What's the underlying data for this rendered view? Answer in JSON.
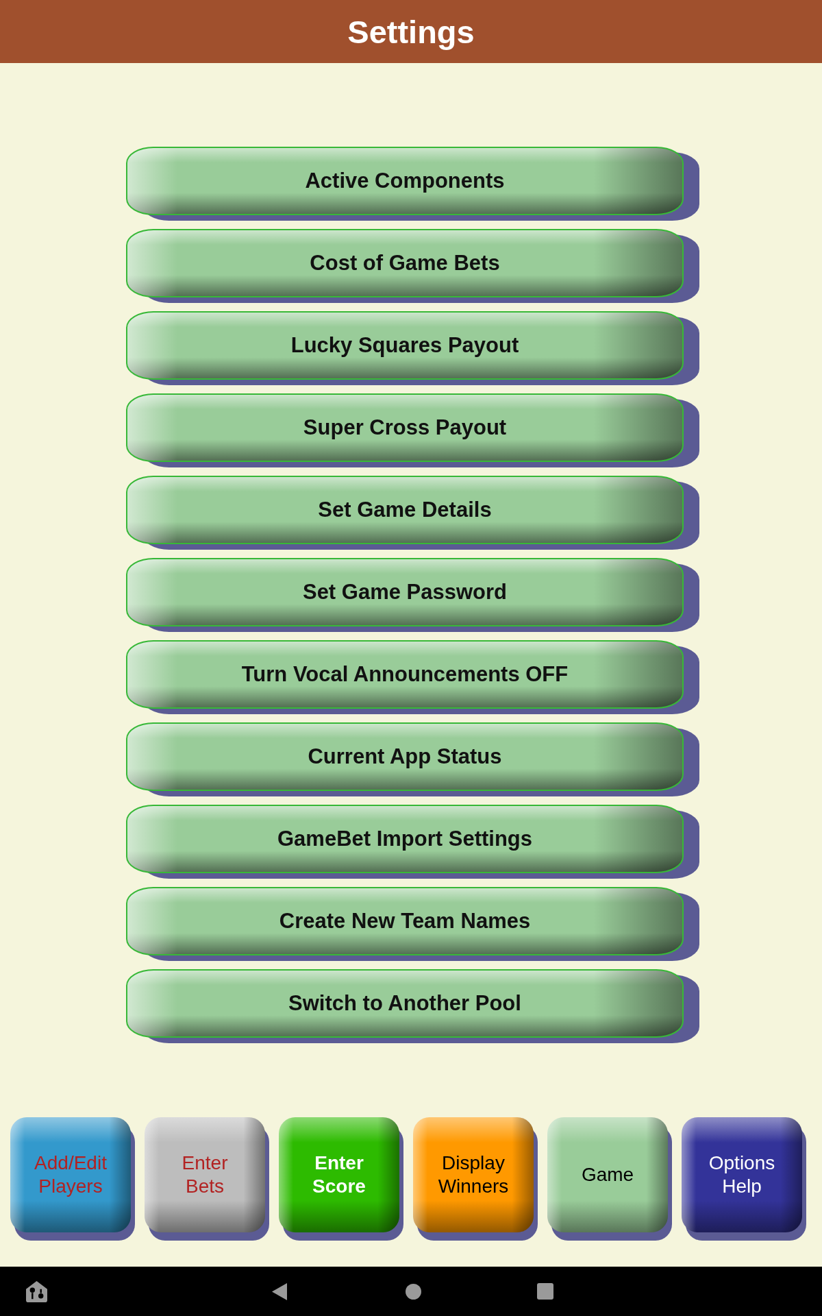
{
  "header": {
    "title": "Settings"
  },
  "settings_buttons": [
    {
      "label": "Active Components"
    },
    {
      "label": "Cost of Game Bets"
    },
    {
      "label": "Lucky Squares Payout"
    },
    {
      "label": "Super Cross Payout"
    },
    {
      "label": "Set Game Details"
    },
    {
      "label": "Set Game Password"
    },
    {
      "label": "Turn Vocal Announcements OFF"
    },
    {
      "label": "Current App Status"
    },
    {
      "label": "GameBet Import Settings"
    },
    {
      "label": "Create New Team Names"
    },
    {
      "label": "Switch to Another Pool"
    }
  ],
  "bottom_buttons": [
    {
      "label": "Add/Edit\nPlayers",
      "color": "#3399cc",
      "kind": "warning"
    },
    {
      "label": "Enter\nBets",
      "color": "#bdbdbd",
      "kind": "warning"
    },
    {
      "label": "Enter\nScore",
      "color": "#2dbb00",
      "kind": "strong"
    },
    {
      "label": "Display\nWinners",
      "color": "#ff9900",
      "kind": "dark"
    },
    {
      "label": "Game",
      "color": "#99cc99",
      "kind": "dark"
    },
    {
      "label": "Options\nHelp",
      "color": "#333399",
      "kind": "light"
    }
  ]
}
